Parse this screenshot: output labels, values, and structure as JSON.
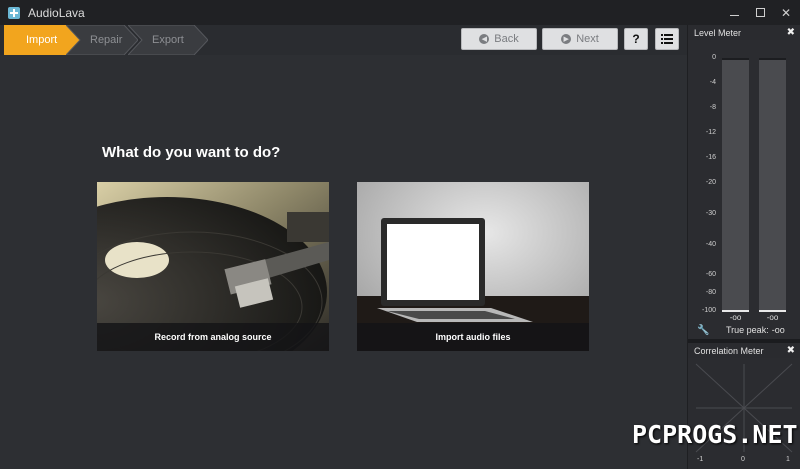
{
  "window": {
    "title": "AudioLava",
    "minimize": "",
    "maximize": "",
    "close": "✕"
  },
  "steps": [
    {
      "label": "Import",
      "active": true
    },
    {
      "label": "Repair",
      "active": false
    },
    {
      "label": "Export",
      "active": false
    }
  ],
  "toolbar": {
    "back_label": "Back",
    "next_label": "Next",
    "help_label": "?"
  },
  "main": {
    "question": "What do you want to do?",
    "cards": [
      {
        "label": "Record from analog source"
      },
      {
        "label": "Import audio files"
      }
    ]
  },
  "level_meter": {
    "title": "Level Meter",
    "close": "✖",
    "scale": [
      "0",
      "-4",
      "-8",
      "-12",
      "-16",
      "-20",
      "-30",
      "-40",
      "-60",
      "-80",
      "-100"
    ],
    "left_value": "-oo",
    "right_value": "-oo",
    "true_peak_label": "True peak:",
    "true_peak_value": "-oo"
  },
  "correlation_meter": {
    "title": "Correlation Meter",
    "close": "✖",
    "scale": [
      "-1",
      "0",
      "1"
    ]
  },
  "watermark": "PCPROGS.NET",
  "colors": {
    "accent": "#f2a51e",
    "background": "#2d2f33",
    "panel": "#2b2c30"
  }
}
